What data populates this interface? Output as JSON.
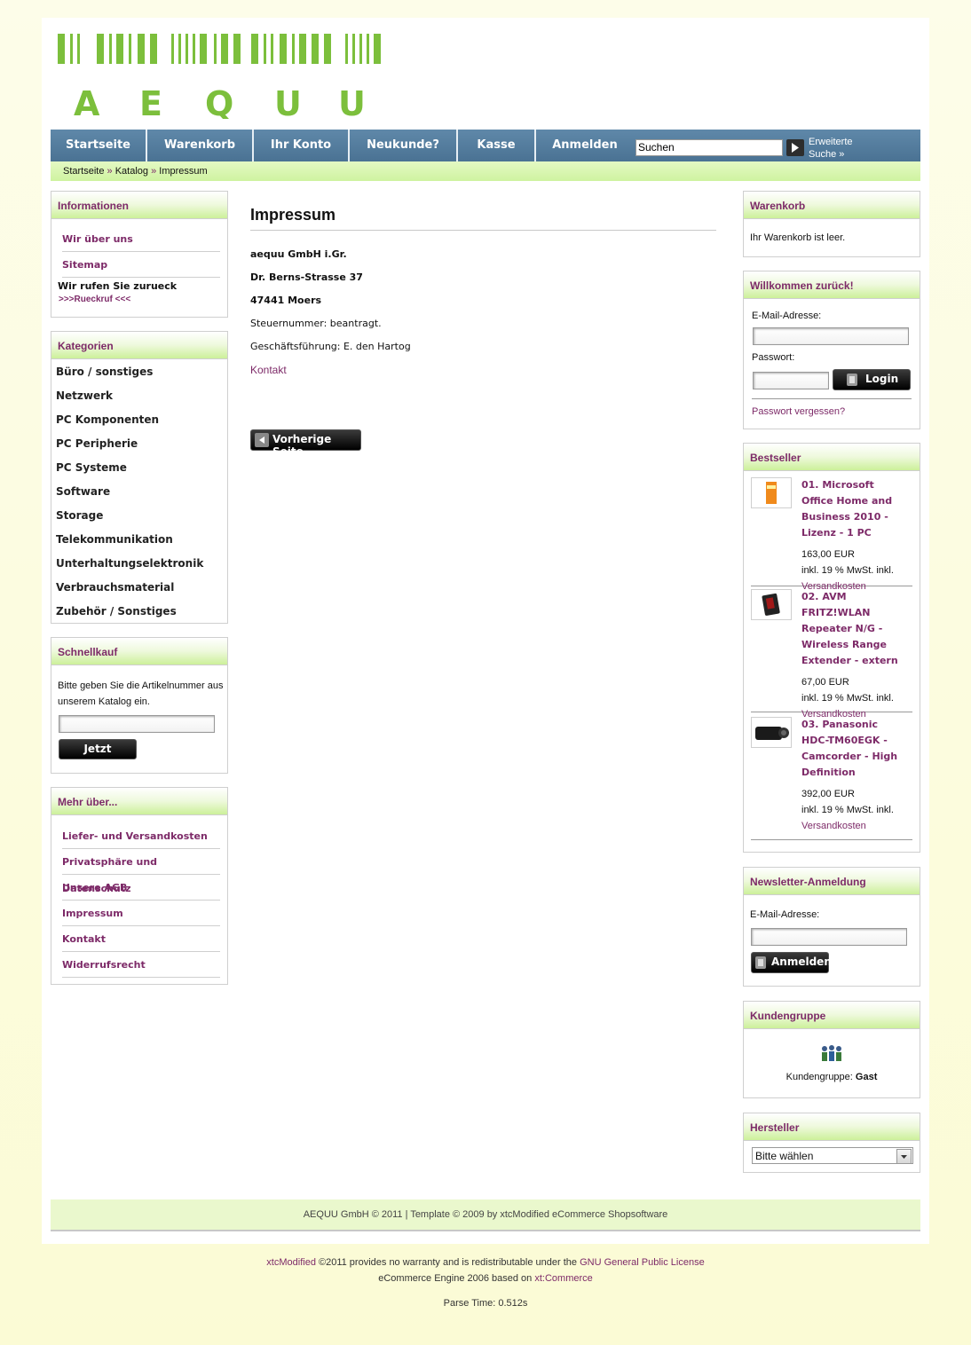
{
  "logo": {
    "text": "A E Q U U",
    "letters": [
      "A",
      "E",
      "Q",
      "U",
      "U"
    ],
    "color": "#7cbf3c"
  },
  "nav": {
    "items": [
      "Startseite",
      "Warenkorb",
      "Ihr Konto",
      "Neukunde?",
      "Kasse",
      "Anmelden"
    ],
    "search_value": "Suchen",
    "advanced_search": "Erweiterte Suche »"
  },
  "breadcrumb": {
    "items": [
      "Startseite",
      "Katalog",
      "Impressum"
    ],
    "separator": "»"
  },
  "info_box": {
    "title": "Informationen",
    "links": [
      "Wir über uns",
      "Sitemap"
    ],
    "callback_text": "Wir rufen Sie zurueck",
    "callback_link": ">>>Rueckruf <<<"
  },
  "categories": {
    "title": "Kategorien",
    "items": [
      "Büro / sonstiges",
      "Netzwerk",
      "PC Komponenten",
      "PC Peripherie",
      "PC Systeme",
      "Software",
      "Storage",
      "Telekommunikation",
      "Unterhaltungselektronik",
      "Verbrauchsmaterial",
      "Zubehör / Sonstiges"
    ]
  },
  "quickbuy": {
    "title": "Schnellkauf",
    "text": "Bitte geben Sie die Artikelnummer aus unserem Katalog ein.",
    "button": "Jetzt kaufen!"
  },
  "more_about": {
    "title": "Mehr über...",
    "links": [
      "Liefer- und Versandkosten",
      "Privatsphäre und Datenschutz",
      "Unsere AGB",
      "Impressum",
      "Kontakt",
      "Widerrufsrecht"
    ]
  },
  "main": {
    "title": "Impressum",
    "lines": [
      "aequu  GmbH i.Gr.",
      "Dr. Berns-Strasse 37",
      "47441 Moers",
      "Steuernummer: beantragt.",
      "Geschäftsführung: E. den Hartog"
    ],
    "contact_link": "Kontakt",
    "back_button": "Vorherige Seite"
  },
  "cart": {
    "title": "Warenkorb",
    "text": "Ihr Warenkorb ist leer."
  },
  "login": {
    "title": "Willkommen zurück!",
    "email_label": "E-Mail-Adresse:",
    "password_label": "Passwort:",
    "button": "Login",
    "forgot": "Passwort vergessen?"
  },
  "bestseller": {
    "title": "Bestseller",
    "items": [
      {
        "rank": "01.",
        "name": "Microsoft Office Home and Business 2010 - Lizenz - 1 PC",
        "price": "163,00 EUR",
        "tax": "inkl. 19 % MwSt. inkl.",
        "shipping": "Versandkosten"
      },
      {
        "rank": "02.",
        "name": "AVM FRITZ!WLAN Repeater N/G - Wireless Range Extender - extern",
        "price": "67,00 EUR",
        "tax": "inkl. 19 % MwSt. inkl.",
        "shipping": "Versandkosten"
      },
      {
        "rank": "03.",
        "name": "Panasonic HDC-TM60EGK - Camcorder - High Definition",
        "price": "392,00 EUR",
        "tax": "inkl. 19 % MwSt. inkl.",
        "shipping": "Versandkosten"
      }
    ]
  },
  "newsletter": {
    "title": "Newsletter-Anmeldung",
    "email_label": "E-Mail-Adresse:",
    "button": "Anmelden"
  },
  "customer_group": {
    "title": "Kundengruppe",
    "label": "Kundengruppe:",
    "value": "Gast"
  },
  "manufacturer": {
    "title": "Hersteller",
    "select_value": "Bitte wählen"
  },
  "footer": {
    "text": "AEQUU GmbH © 2011 | Template © 2009 by xtcModified eCommerce Shopsoftware"
  },
  "bottom": {
    "xtc_link": "xtcModified",
    "line1_mid": " ©2011 provides no warranty and is redistributable under the ",
    "gpl_link": "GNU General Public License",
    "line2_pre": "eCommerce Engine 2006 based on ",
    "xtcommerce_link": "xt:Commerce",
    "parse_time": "Parse Time: 0.512s"
  }
}
